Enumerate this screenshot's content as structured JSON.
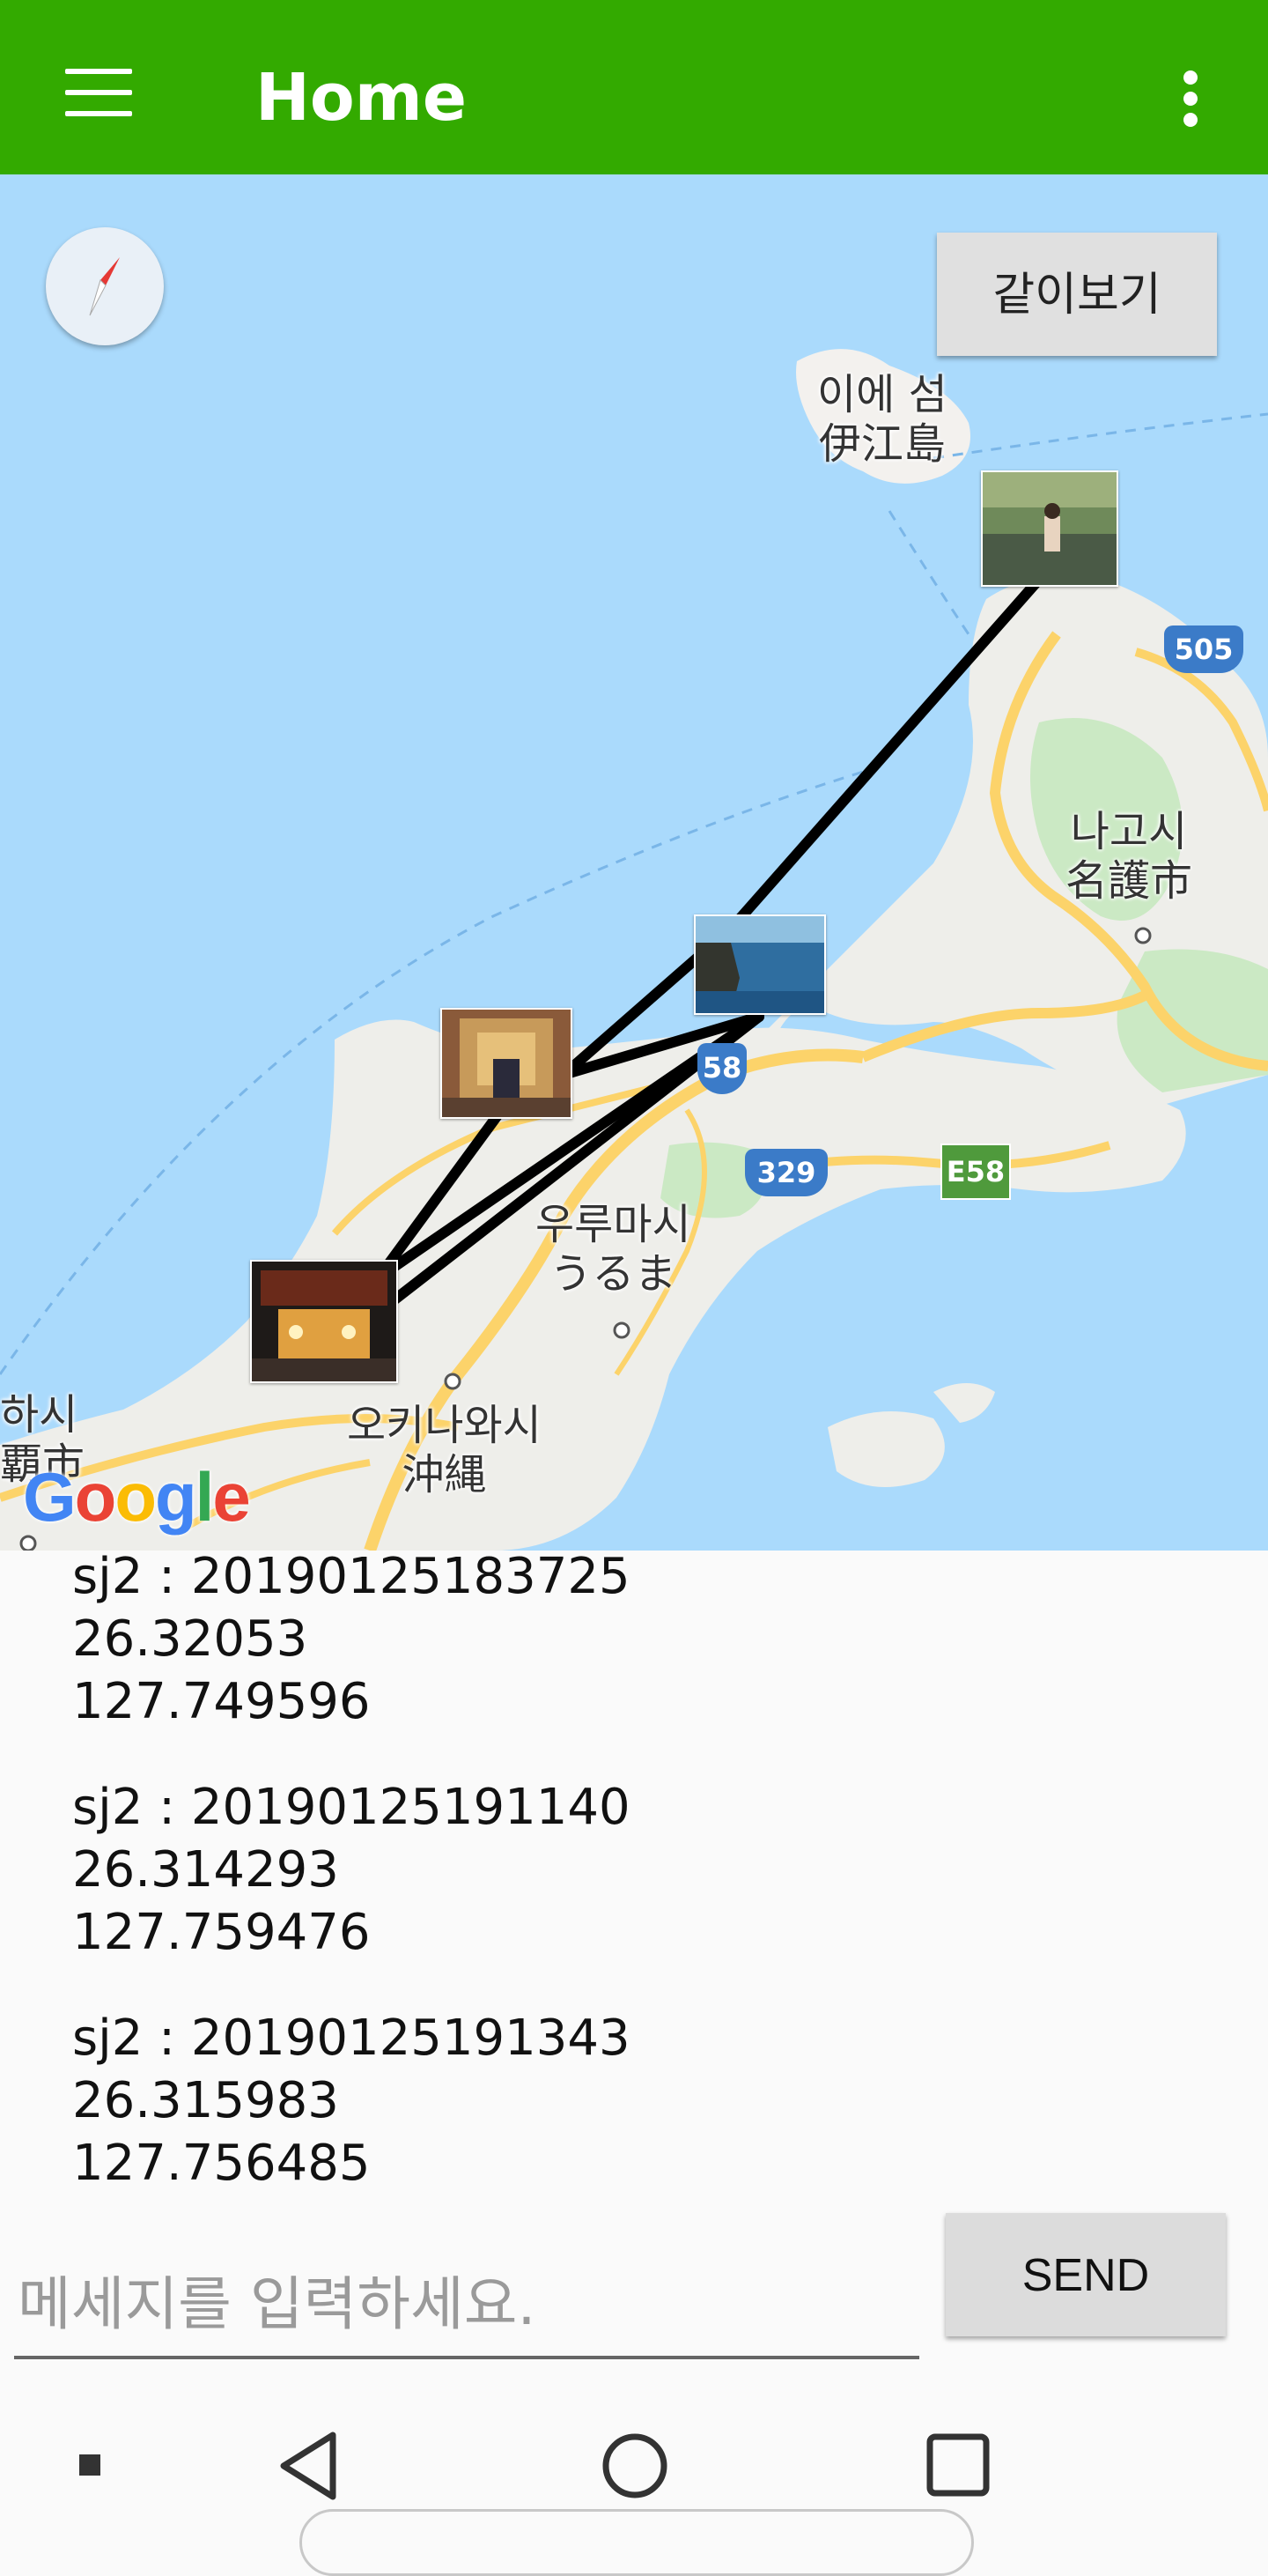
{
  "app_bar": {
    "title": "Home",
    "background_color": "#33aa00",
    "menu_icon": "hamburger-menu-icon",
    "overflow_icon": "more-vert-icon"
  },
  "map": {
    "together_button_label": "같이보기",
    "compass_icon": "compass-icon",
    "labels": {
      "ie_island_ko": "이에 섬",
      "ie_island_ja": "伊江島",
      "nago_ko": "나고시",
      "nago_ja": "名護市",
      "uruma_ko": "우루마시",
      "uruma_ja": "うるま",
      "okinawa_ko": "오키나와시",
      "okinawa_ja": "沖縄",
      "naha_ko": "하시",
      "naha_ja": "覇市"
    },
    "route_shields": {
      "r505": "505",
      "r58": "58",
      "r329": "329",
      "e58": "E58"
    },
    "google_logo": [
      "G",
      "o",
      "o",
      "g",
      "l",
      "e"
    ]
  },
  "messages": [
    {
      "header": "sj2 : 20190125183725",
      "lat": "26.32053",
      "lng": "127.749596"
    },
    {
      "header": "sj2 : 20190125191140",
      "lat": "26.314293",
      "lng": "127.759476"
    },
    {
      "header": "sj2 : 20190125191343",
      "lat": "26.315983",
      "lng": "127.756485"
    }
  ],
  "composer": {
    "placeholder": "메세지를 입력하세요.",
    "send_label": "SEND"
  },
  "nav_bar": {
    "icons": [
      "square-dot-icon",
      "back-icon",
      "home-icon",
      "recents-icon"
    ]
  }
}
